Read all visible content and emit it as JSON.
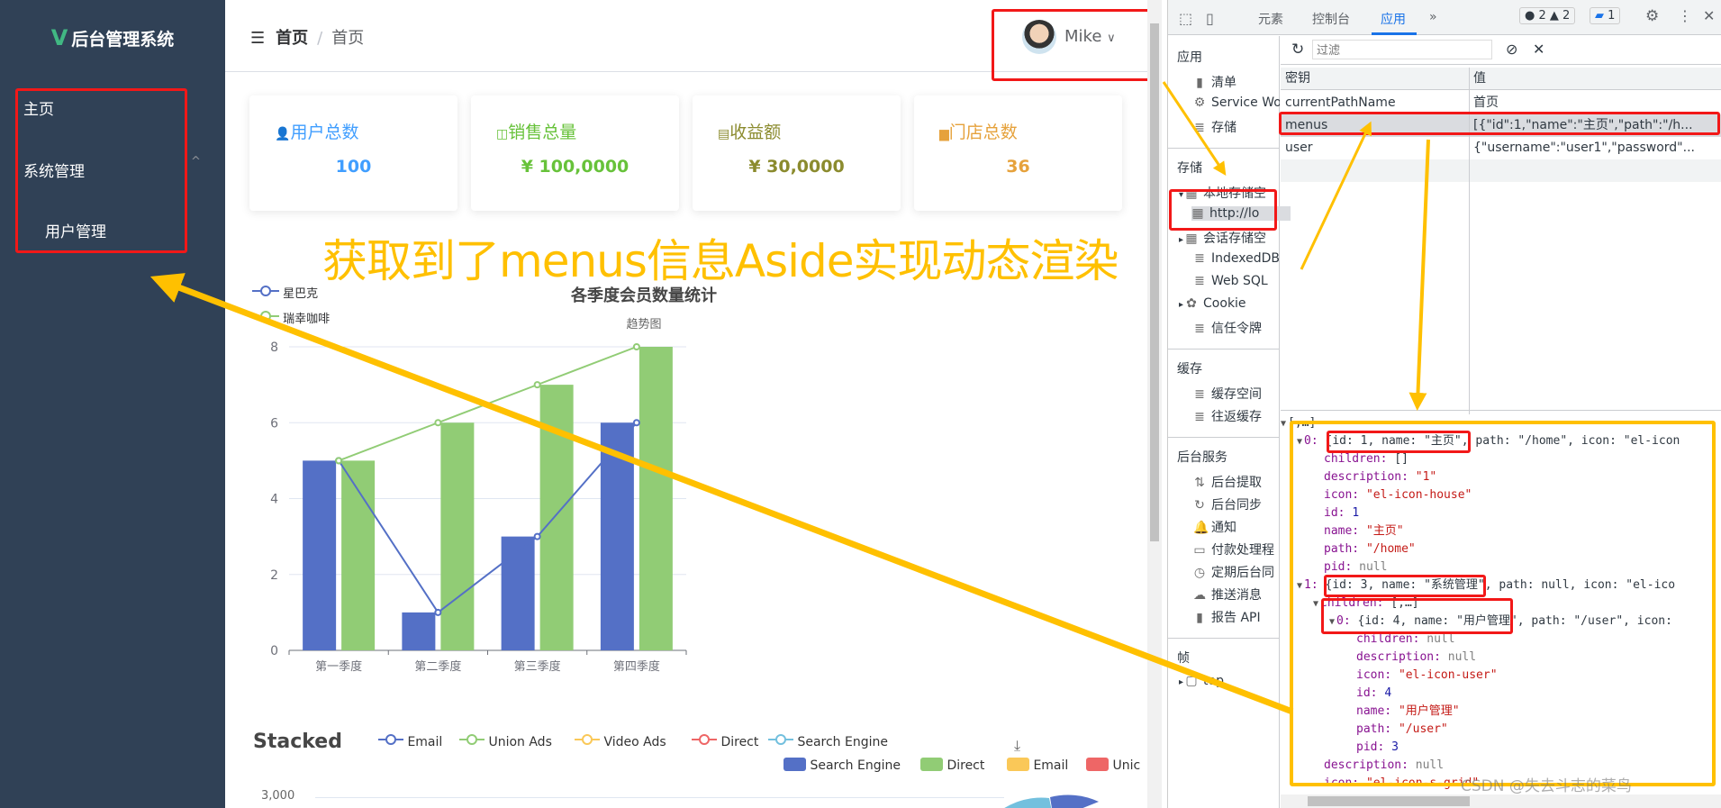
{
  "sidebar": {
    "logo": "后台管理系统",
    "items": [
      {
        "label": "主页"
      },
      {
        "label": "系统管理"
      },
      {
        "label": "用户管理"
      }
    ]
  },
  "header": {
    "crumb_root": "首页",
    "crumb_current": "首页",
    "user": "Mike"
  },
  "cards": [
    {
      "title": "用户总数",
      "value": "100",
      "color": "#409eff",
      "icon": "user-icon"
    },
    {
      "title": "销售总量",
      "value": "¥ 100,0000",
      "color": "#67c23a",
      "icon": "sales-icon"
    },
    {
      "title": "收益额",
      "value": "¥ 30,0000",
      "color": "#8b8b2e",
      "icon": "wallet-icon"
    },
    {
      "title": "门店总数",
      "value": "36",
      "color": "#e6a23c",
      "icon": "store-icon"
    }
  ],
  "annotation": "获取到了menus信息Aside实现动态渲染",
  "chart_data": [
    {
      "type": "bar",
      "title": "各季度会员数量统计",
      "subtitle": "趋势图",
      "categories": [
        "第一季度",
        "第二季度",
        "第三季度",
        "第四季度"
      ],
      "series": [
        {
          "name": "星巴克",
          "values": [
            5,
            1,
            3,
            6
          ],
          "color": "#5470c6",
          "line": true
        },
        {
          "name": "瑞幸咖啡",
          "values": [
            5,
            6,
            7,
            8
          ],
          "color": "#91cc75",
          "line": true
        }
      ],
      "ylim": [
        0,
        8
      ],
      "yticks": [
        0,
        2,
        4,
        6,
        8
      ],
      "grid": true,
      "legend": "top-left"
    },
    {
      "type": "line",
      "title": "Stacked",
      "legend_lines": [
        {
          "name": "Email",
          "color": "#5470c6"
        },
        {
          "name": "Union Ads",
          "color": "#91cc75"
        },
        {
          "name": "Video Ads",
          "color": "#fac858"
        },
        {
          "name": "Direct",
          "color": "#ee6666"
        },
        {
          "name": "Search Engine",
          "color": "#73c0de"
        }
      ],
      "legend_pie": [
        {
          "name": "Search Engine",
          "color": "#5470c6"
        },
        {
          "name": "Direct",
          "color": "#91cc75"
        },
        {
          "name": "Email",
          "color": "#fac858"
        },
        {
          "name": "Unic",
          "color": "#ee6666"
        }
      ],
      "yticks": [
        "3,000"
      ]
    }
  ],
  "devtools": {
    "tabs": [
      "元素",
      "控制台",
      "应用"
    ],
    "active_tab": "应用",
    "errors": "2",
    "warnings": "2",
    "messages": "1",
    "filter_placeholder": "过滤",
    "left": {
      "app_header": "应用",
      "app_items": [
        "清单",
        "Service Wo",
        "存储"
      ],
      "storage_header": "存储",
      "storage_items": [
        "本地存储空",
        "http://lo",
        "会话存储空",
        "IndexedDB",
        "Web SQL",
        "Cookie",
        "信任令牌"
      ],
      "cache_header": "缓存",
      "cache_items": [
        "缓存空间",
        "往返缓存"
      ],
      "bg_header": "后台服务",
      "bg_items": [
        "后台提取",
        "后台同步",
        "通知",
        "付款处理程",
        "定期后台同",
        "推送消息",
        "报告 API"
      ],
      "frames_header": "帧",
      "frame_items": [
        "top"
      ]
    },
    "table": {
      "col_key": "密钥",
      "col_value": "值",
      "rows": [
        {
          "key": "currentPathName",
          "value": "首页"
        },
        {
          "key": "menus",
          "value": "[{\"id\":1,\"name\":\"主页\",\"path\":\"/h..."
        },
        {
          "key": "user",
          "value": "{\"username\":\"user1\",\"password\"..."
        }
      ]
    },
    "preview": [
      {
        "depth": 0,
        "toggle": "▼",
        "key": "",
        "val": "[,…]",
        "t": "plain"
      },
      {
        "depth": 1,
        "toggle": "▼",
        "key": "0: ",
        "val": "{id: 1, name: \"主页\", path: \"/home\", icon: \"el-icon",
        "t": "plain"
      },
      {
        "depth": 2,
        "toggle": "",
        "key": "children: ",
        "val": "[]",
        "t": "plain"
      },
      {
        "depth": 2,
        "toggle": "",
        "key": "description: ",
        "val": "\"1\"",
        "t": "s"
      },
      {
        "depth": 2,
        "toggle": "",
        "key": "icon: ",
        "val": "\"el-icon-house\"",
        "t": "s"
      },
      {
        "depth": 2,
        "toggle": "",
        "key": "id: ",
        "val": "1",
        "t": "n"
      },
      {
        "depth": 2,
        "toggle": "",
        "key": "name: ",
        "val": "\"主页\"",
        "t": "s"
      },
      {
        "depth": 2,
        "toggle": "",
        "key": "path: ",
        "val": "\"/home\"",
        "t": "s"
      },
      {
        "depth": 2,
        "toggle": "",
        "key": "pid: ",
        "val": "null",
        "t": "nl"
      },
      {
        "depth": 1,
        "toggle": "▼",
        "key": "1: ",
        "val": "{id: 3, name: \"系统管理\", path: null, icon: \"el-ico",
        "t": "plain"
      },
      {
        "depth": 2,
        "toggle": "▼",
        "key": "children: ",
        "val": "[,…]",
        "t": "plain"
      },
      {
        "depth": 3,
        "toggle": "▼",
        "key": "0: ",
        "val": "{id: 4, name: \"用户管理\", path: \"/user\", icon:",
        "t": "plain"
      },
      {
        "depth": 4,
        "toggle": "",
        "key": "children: ",
        "val": "null",
        "t": "nl"
      },
      {
        "depth": 4,
        "toggle": "",
        "key": "description: ",
        "val": "null",
        "t": "nl"
      },
      {
        "depth": 4,
        "toggle": "",
        "key": "icon: ",
        "val": "\"el-icon-user\"",
        "t": "s"
      },
      {
        "depth": 4,
        "toggle": "",
        "key": "id: ",
        "val": "4",
        "t": "n"
      },
      {
        "depth": 4,
        "toggle": "",
        "key": "name: ",
        "val": "\"用户管理\"",
        "t": "s"
      },
      {
        "depth": 4,
        "toggle": "",
        "key": "path: ",
        "val": "\"/user\"",
        "t": "s"
      },
      {
        "depth": 4,
        "toggle": "",
        "key": "pid: ",
        "val": "3",
        "t": "n"
      },
      {
        "depth": 2,
        "toggle": "",
        "key": "description: ",
        "val": "null",
        "t": "nl"
      },
      {
        "depth": 2,
        "toggle": "",
        "key": "icon: ",
        "val": "\"el-icon-s-grid\"",
        "t": "s"
      }
    ]
  },
  "watermark": "CSDN @失去斗志的菜鸟"
}
